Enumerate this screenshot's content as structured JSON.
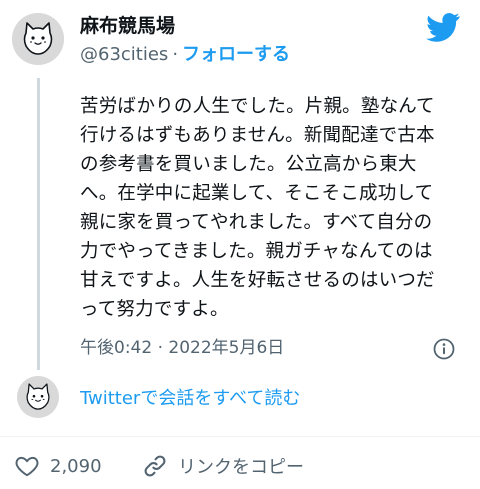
{
  "user": {
    "display_name": "麻布競馬場",
    "handle": "@63cities",
    "separator": "·",
    "follow_label": "フォローする"
  },
  "tweet": {
    "lines": "苦労ばかりの人生でした。片親。塾なんて\n行けるはずもありません。新聞配達で古本\nの参考書を買いました。公立高から東大\nへ。在学中に起業して、そこそこ成功して\n親に家を買ってやれました。すべて自分の\n力でやってきました。親ガチャなんてのは\n甘えですよ。人生を好転させるのはいつだ\nって努力ですよ。",
    "timestamp": "午後0:42 · 2022年5月6日"
  },
  "thread": {
    "link_label": "Twitterで会話をすべて読む"
  },
  "actions": {
    "like_count": "2,090",
    "copy_link_label": "リンクをコピー"
  },
  "colors": {
    "accent": "#1d9bf0",
    "secondary_text": "#536471",
    "avatar_bg": "#d9d9d9"
  },
  "icons": [
    "cat-face-icon",
    "twitter-bird-icon",
    "info-icon",
    "heart-icon",
    "link-icon"
  ]
}
